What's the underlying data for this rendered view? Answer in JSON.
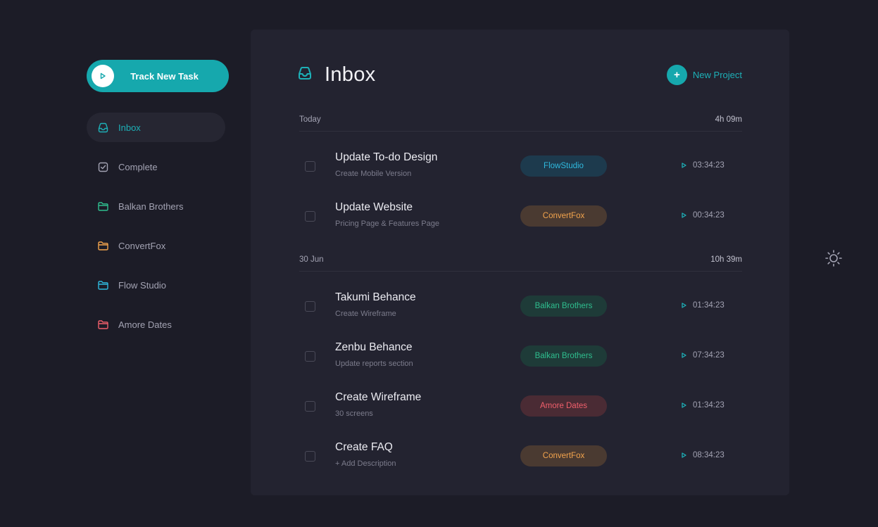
{
  "sidebar": {
    "track_label": "Track New Task",
    "nav": [
      {
        "label": "Inbox",
        "icon": "inbox-icon",
        "color": "#1db0b7",
        "active": true
      },
      {
        "label": "Complete",
        "icon": "check-square-icon",
        "color": "#a3a3b3",
        "active": false
      },
      {
        "label": "Balkan Brothers",
        "icon": "folder-icon",
        "color": "#2fbf8f",
        "active": false
      },
      {
        "label": "ConvertFox",
        "icon": "folder-icon",
        "color": "#f3a44d",
        "active": false
      },
      {
        "label": "Flow Studio",
        "icon": "folder-icon",
        "color": "#2fb9de",
        "active": false
      },
      {
        "label": "Amore Dates",
        "icon": "folder-icon",
        "color": "#f05f6b",
        "active": false
      }
    ]
  },
  "main": {
    "title": "Inbox",
    "new_project_label": "New Project",
    "groups": [
      {
        "label": "Today",
        "total": "4h 09m",
        "tasks": [
          {
            "title": "Update To-do Design",
            "desc": "Create Mobile Version",
            "tag": "FlowStudio",
            "tag_style": "flow",
            "time": "03:34:23"
          },
          {
            "title": "Update Website",
            "desc": "Pricing Page & Features Page",
            "tag": "ConvertFox",
            "tag_style": "convert",
            "time": "00:34:23"
          }
        ]
      },
      {
        "label": "30 Jun",
        "total": "10h 39m",
        "tasks": [
          {
            "title": "Takumi Behance",
            "desc": "Create Wireframe",
            "tag": "Balkan Brothers",
            "tag_style": "balkan",
            "time": "01:34:23"
          },
          {
            "title": "Zenbu Behance",
            "desc": "Update reports section",
            "tag": "Balkan Brothers",
            "tag_style": "balkan",
            "time": "07:34:23"
          },
          {
            "title": "Create Wireframe",
            "desc": "30 screens",
            "tag": "Amore Dates",
            "tag_style": "amore",
            "time": "01:34:23"
          },
          {
            "title": "Create FAQ",
            "desc": "+ Add Description",
            "tag": "ConvertFox",
            "tag_style": "convert",
            "time": "08:34:23"
          }
        ]
      }
    ]
  },
  "colors": {
    "accent": "#16a8ad",
    "background": "#1c1c27",
    "panel": "#232330"
  }
}
